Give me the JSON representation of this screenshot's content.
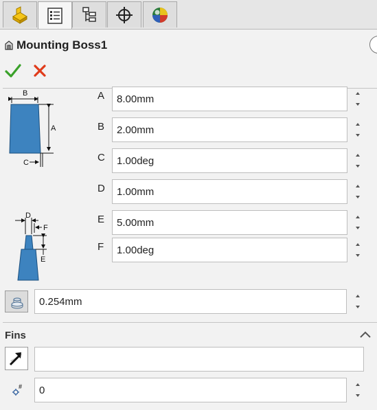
{
  "colors": {
    "accent": "#3a7dbb",
    "ok_green": "#3aa12a",
    "cancel_red": "#e03b1a"
  },
  "tabs": [
    {
      "icon": "feature-manager-icon"
    },
    {
      "icon": "property-manager-icon"
    },
    {
      "icon": "configuration-manager-icon"
    },
    {
      "icon": "dimxpert-icon"
    },
    {
      "icon": "display-manager-icon"
    }
  ],
  "title": {
    "text": "Mounting Boss1",
    "icon": "boss-feature-icon"
  },
  "actions": {
    "ok_icon": "checkmark-icon",
    "cancel_icon": "x-icon"
  },
  "params": [
    {
      "label": "A",
      "value": "8.00mm"
    },
    {
      "label": "B",
      "value": "2.00mm"
    },
    {
      "label": "C",
      "value": "1.00deg"
    },
    {
      "label": "D",
      "value": "1.00mm"
    },
    {
      "label": "E",
      "value": "5.00mm"
    },
    {
      "label": "F",
      "value": "1.00deg"
    }
  ],
  "diagram_labels": {
    "top": {
      "b": "B",
      "a": "A",
      "c": "C"
    },
    "bottom": {
      "d": "D",
      "f": "F",
      "e": "E"
    }
  },
  "clearance": {
    "value": "0.254mm",
    "icon": "clearance-icon"
  },
  "fins": {
    "heading": "Fins",
    "direction_value": "",
    "direction_icon": "select-direction-icon",
    "count_value": "0",
    "count_icon": "number-of-fins-icon"
  }
}
